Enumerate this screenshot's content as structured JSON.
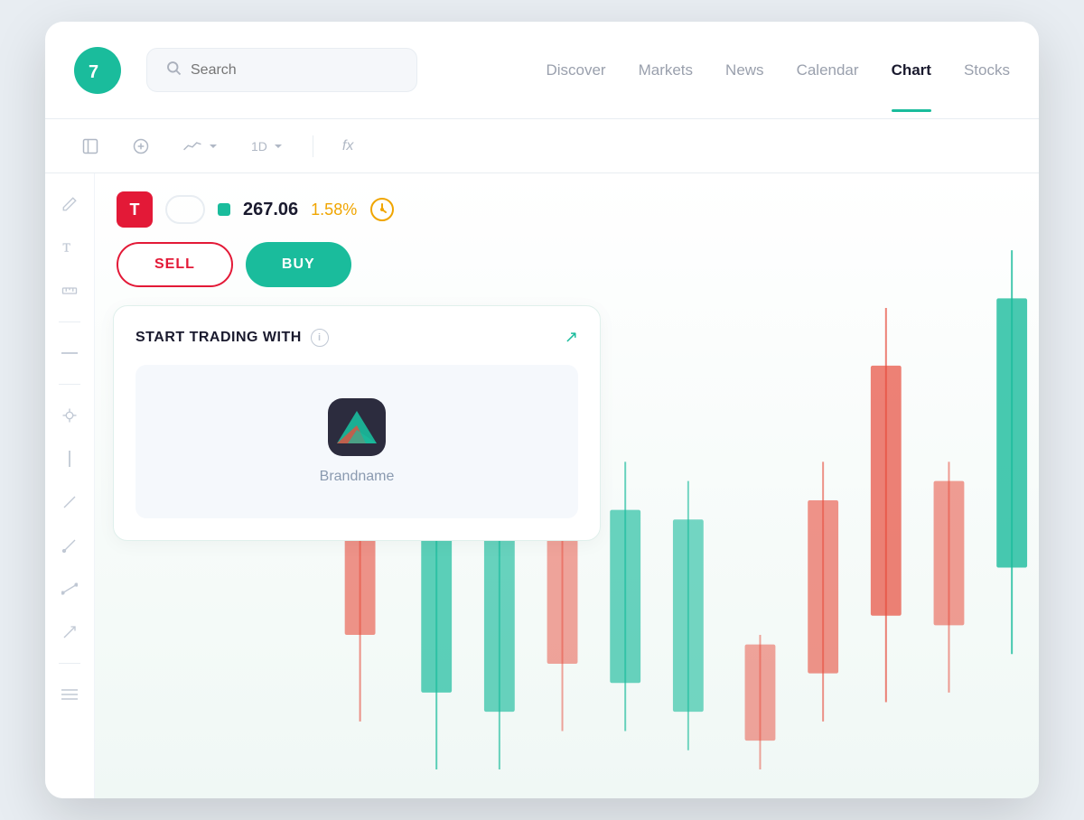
{
  "header": {
    "logo_alt": "Logo",
    "search_placeholder": "Search",
    "nav": [
      {
        "id": "discover",
        "label": "Discover",
        "active": false
      },
      {
        "id": "markets",
        "label": "Markets",
        "active": false
      },
      {
        "id": "news",
        "label": "News",
        "active": false
      },
      {
        "id": "calendar",
        "label": "Calendar",
        "active": false
      },
      {
        "id": "chart",
        "label": "Chart",
        "active": true
      },
      {
        "id": "stocks",
        "label": "Stocks",
        "active": false
      }
    ]
  },
  "toolbar": {
    "timeframe": "1D",
    "fx_label": "fx"
  },
  "stock": {
    "symbol": "T",
    "price": "267.06",
    "change_percent": "1.58%"
  },
  "trade": {
    "sell_label": "SELL",
    "buy_label": "BUY"
  },
  "trading_card": {
    "title": "START TRADING WITH",
    "broker_name": "Brandname"
  },
  "tools": [
    "pencil",
    "text",
    "ruler",
    "line-h",
    "crosshair",
    "line-v",
    "line-diag1",
    "line-diag2",
    "line-diag3",
    "line-diag4",
    "lines-h"
  ]
}
